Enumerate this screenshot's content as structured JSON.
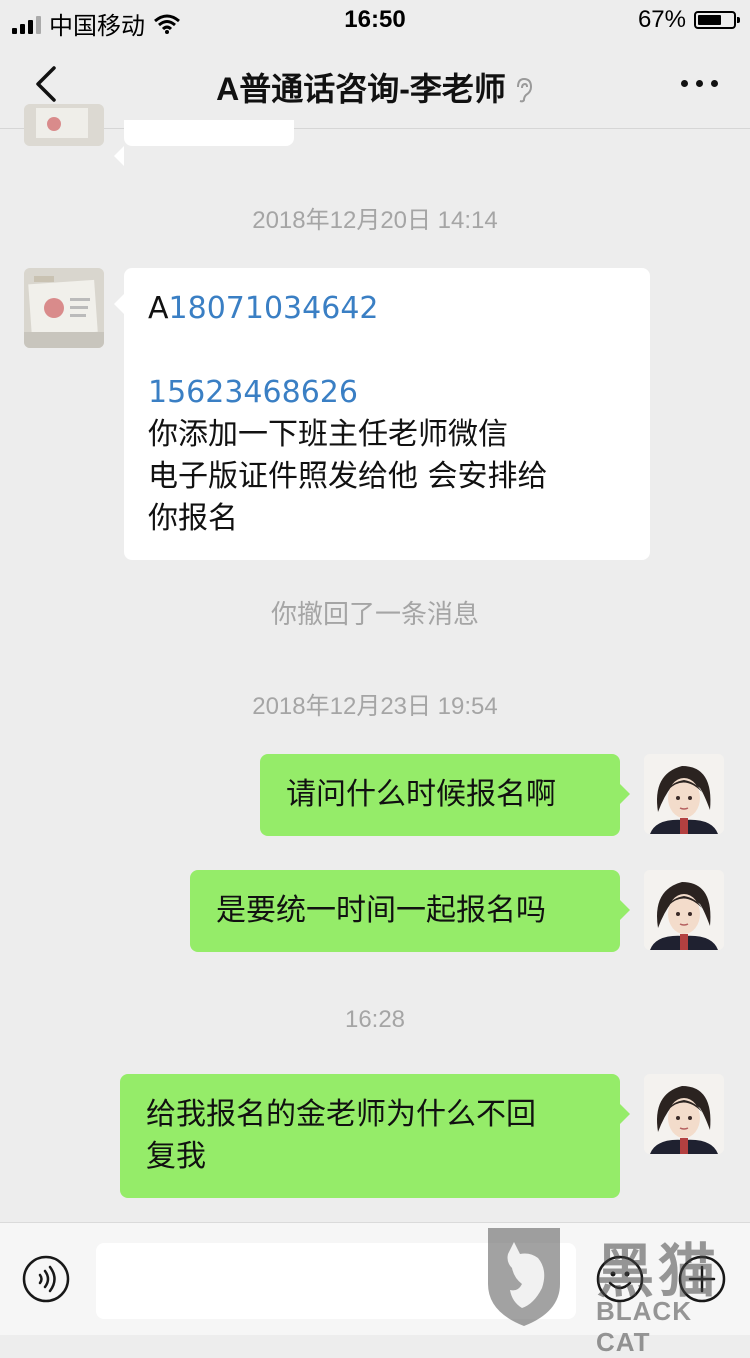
{
  "status_bar": {
    "carrier": "中国移动",
    "time": "16:50",
    "battery_percent": "67%",
    "battery_level": 0.67
  },
  "nav": {
    "title": "A普通话咨询-李老师",
    "back_icon": "chevron-left-icon",
    "more_icon": "more-dots-icon"
  },
  "messages": {
    "timestamp_1": "2018年12月20日 14:14",
    "teacher_msg": {
      "prefix": "A",
      "phone_1": "18071034642",
      "phone_2": "15623468626",
      "line_1": "你添加一下班主任老师微信",
      "line_2": "电子版证件照发给他 会安排给",
      "line_3": "你报名"
    },
    "system_notice": "你撤回了一条消息",
    "timestamp_2": "2018年12月23日 19:54",
    "my_msg_1": "请问什么时候报名啊",
    "my_msg_2": "是要统一时间一起报名吗",
    "timestamp_3": "16:28",
    "my_msg_3_line_1": "给我报名的金老师为什么不回",
    "my_msg_3_line_2": "复我"
  },
  "input_bar": {
    "voice_icon": "voice-icon",
    "emoji_icon": "emoji-icon",
    "plus_icon": "plus-icon"
  },
  "watermark": {
    "cn": "黑猫",
    "en": "BLACK CAT"
  },
  "colors": {
    "background": "#ededed",
    "bubble_green": "#95ec69",
    "bubble_white": "#ffffff",
    "link": "#3a7fc4",
    "timestamp": "#a5a5a5"
  }
}
